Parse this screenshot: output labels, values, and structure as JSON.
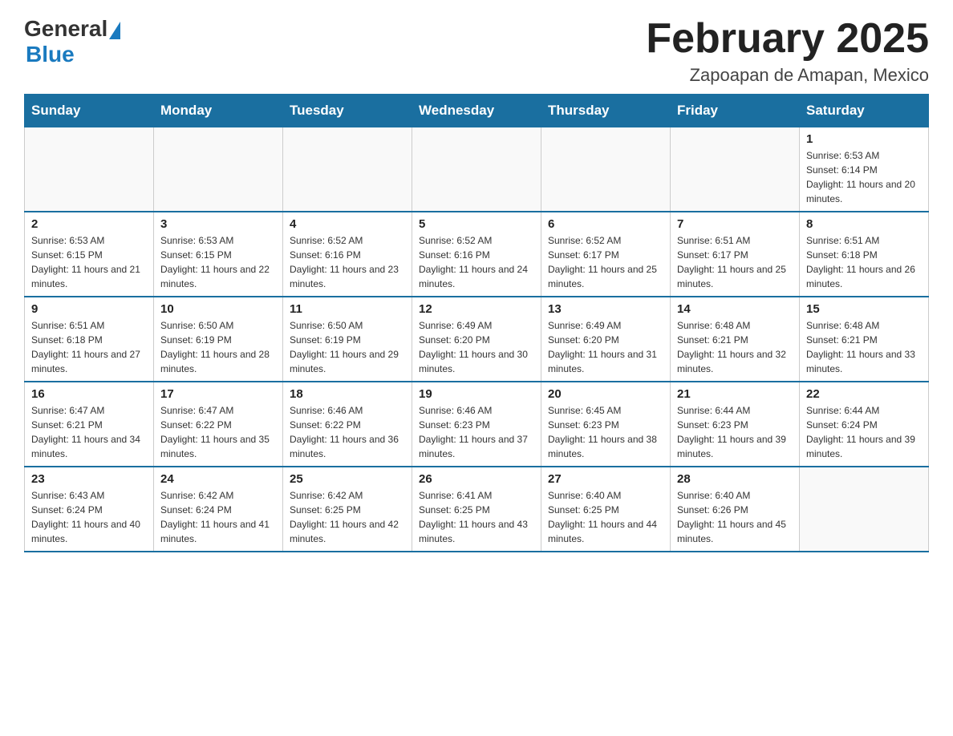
{
  "logo": {
    "general": "General",
    "blue": "Blue"
  },
  "title": "February 2025",
  "location": "Zapoapan de Amapan, Mexico",
  "days_of_week": [
    "Sunday",
    "Monday",
    "Tuesday",
    "Wednesday",
    "Thursday",
    "Friday",
    "Saturday"
  ],
  "weeks": [
    [
      {
        "day": "",
        "info": ""
      },
      {
        "day": "",
        "info": ""
      },
      {
        "day": "",
        "info": ""
      },
      {
        "day": "",
        "info": ""
      },
      {
        "day": "",
        "info": ""
      },
      {
        "day": "",
        "info": ""
      },
      {
        "day": "1",
        "info": "Sunrise: 6:53 AM\nSunset: 6:14 PM\nDaylight: 11 hours and 20 minutes."
      }
    ],
    [
      {
        "day": "2",
        "info": "Sunrise: 6:53 AM\nSunset: 6:15 PM\nDaylight: 11 hours and 21 minutes."
      },
      {
        "day": "3",
        "info": "Sunrise: 6:53 AM\nSunset: 6:15 PM\nDaylight: 11 hours and 22 minutes."
      },
      {
        "day": "4",
        "info": "Sunrise: 6:52 AM\nSunset: 6:16 PM\nDaylight: 11 hours and 23 minutes."
      },
      {
        "day": "5",
        "info": "Sunrise: 6:52 AM\nSunset: 6:16 PM\nDaylight: 11 hours and 24 minutes."
      },
      {
        "day": "6",
        "info": "Sunrise: 6:52 AM\nSunset: 6:17 PM\nDaylight: 11 hours and 25 minutes."
      },
      {
        "day": "7",
        "info": "Sunrise: 6:51 AM\nSunset: 6:17 PM\nDaylight: 11 hours and 25 minutes."
      },
      {
        "day": "8",
        "info": "Sunrise: 6:51 AM\nSunset: 6:18 PM\nDaylight: 11 hours and 26 minutes."
      }
    ],
    [
      {
        "day": "9",
        "info": "Sunrise: 6:51 AM\nSunset: 6:18 PM\nDaylight: 11 hours and 27 minutes."
      },
      {
        "day": "10",
        "info": "Sunrise: 6:50 AM\nSunset: 6:19 PM\nDaylight: 11 hours and 28 minutes."
      },
      {
        "day": "11",
        "info": "Sunrise: 6:50 AM\nSunset: 6:19 PM\nDaylight: 11 hours and 29 minutes."
      },
      {
        "day": "12",
        "info": "Sunrise: 6:49 AM\nSunset: 6:20 PM\nDaylight: 11 hours and 30 minutes."
      },
      {
        "day": "13",
        "info": "Sunrise: 6:49 AM\nSunset: 6:20 PM\nDaylight: 11 hours and 31 minutes."
      },
      {
        "day": "14",
        "info": "Sunrise: 6:48 AM\nSunset: 6:21 PM\nDaylight: 11 hours and 32 minutes."
      },
      {
        "day": "15",
        "info": "Sunrise: 6:48 AM\nSunset: 6:21 PM\nDaylight: 11 hours and 33 minutes."
      }
    ],
    [
      {
        "day": "16",
        "info": "Sunrise: 6:47 AM\nSunset: 6:21 PM\nDaylight: 11 hours and 34 minutes."
      },
      {
        "day": "17",
        "info": "Sunrise: 6:47 AM\nSunset: 6:22 PM\nDaylight: 11 hours and 35 minutes."
      },
      {
        "day": "18",
        "info": "Sunrise: 6:46 AM\nSunset: 6:22 PM\nDaylight: 11 hours and 36 minutes."
      },
      {
        "day": "19",
        "info": "Sunrise: 6:46 AM\nSunset: 6:23 PM\nDaylight: 11 hours and 37 minutes."
      },
      {
        "day": "20",
        "info": "Sunrise: 6:45 AM\nSunset: 6:23 PM\nDaylight: 11 hours and 38 minutes."
      },
      {
        "day": "21",
        "info": "Sunrise: 6:44 AM\nSunset: 6:23 PM\nDaylight: 11 hours and 39 minutes."
      },
      {
        "day": "22",
        "info": "Sunrise: 6:44 AM\nSunset: 6:24 PM\nDaylight: 11 hours and 39 minutes."
      }
    ],
    [
      {
        "day": "23",
        "info": "Sunrise: 6:43 AM\nSunset: 6:24 PM\nDaylight: 11 hours and 40 minutes."
      },
      {
        "day": "24",
        "info": "Sunrise: 6:42 AM\nSunset: 6:24 PM\nDaylight: 11 hours and 41 minutes."
      },
      {
        "day": "25",
        "info": "Sunrise: 6:42 AM\nSunset: 6:25 PM\nDaylight: 11 hours and 42 minutes."
      },
      {
        "day": "26",
        "info": "Sunrise: 6:41 AM\nSunset: 6:25 PM\nDaylight: 11 hours and 43 minutes."
      },
      {
        "day": "27",
        "info": "Sunrise: 6:40 AM\nSunset: 6:25 PM\nDaylight: 11 hours and 44 minutes."
      },
      {
        "day": "28",
        "info": "Sunrise: 6:40 AM\nSunset: 6:26 PM\nDaylight: 11 hours and 45 minutes."
      },
      {
        "day": "",
        "info": ""
      }
    ]
  ]
}
